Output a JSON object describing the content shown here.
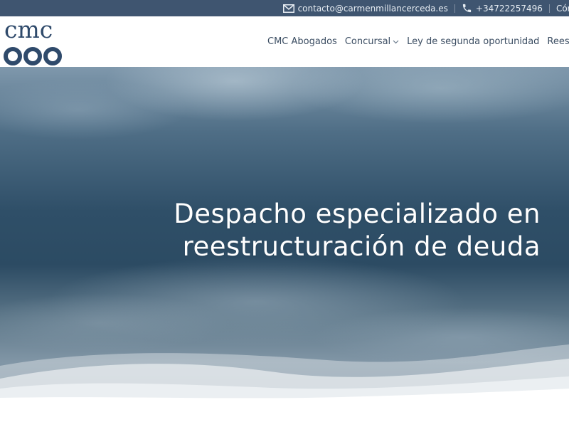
{
  "topbar": {
    "email": "contacto@carmenmillancerceda.es",
    "phone": "+34722257496",
    "city": "Córd"
  },
  "logo": {
    "text": "cmc"
  },
  "nav": {
    "items": [
      {
        "label": "CMC Abogados",
        "has_dropdown": false
      },
      {
        "label": "Concursal",
        "has_dropdown": true
      },
      {
        "label": "Ley de segunda oportunidad",
        "has_dropdown": false
      },
      {
        "label": "Reestructuraci",
        "has_dropdown": false
      }
    ]
  },
  "hero": {
    "title_line1": "Despacho especializado en",
    "title_line2": "reestructuración de deuda"
  },
  "colors": {
    "topbar_bg": "#3f5570",
    "brand": "#2f4a6b",
    "nav_text": "#3c4e63",
    "hero_text": "#ffffff"
  }
}
